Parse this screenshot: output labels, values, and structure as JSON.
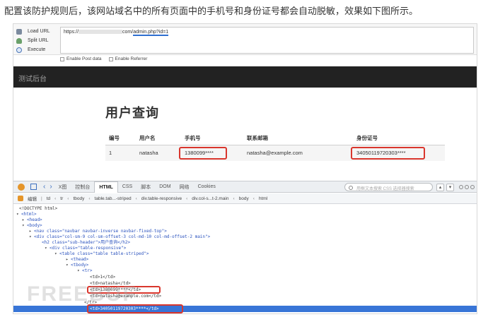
{
  "caption": "配置该防护规则后，该网站域名中的所有页面中的手机号和身份证号都会自动脱敏，效果如下图所示。",
  "hackbar": {
    "actions": [
      "Load URL",
      "Split URL",
      "Execute"
    ],
    "url_prefix": "https://",
    "url_mid": "com/",
    "url_highlight": "admin.php?id=1",
    "options": [
      "Enable Post data",
      "Enable Referrer"
    ]
  },
  "site": {
    "brand": "测试后台",
    "page_title": "用户查询",
    "columns": [
      "编号",
      "用户名",
      "手机号",
      "联系邮箱",
      "身份证号"
    ],
    "rows": [
      [
        "1",
        "natasha",
        "1380099****",
        "natasha@example.com",
        "34050119720303****"
      ]
    ]
  },
  "firebug": {
    "tabs": [
      "X图",
      "控制台",
      "HTML",
      "CSS",
      "脚本",
      "DOM",
      "网络",
      "Cookies"
    ],
    "active_tab": "HTML",
    "search_placeholder": "用框文本搜索 CSS 选择器搜索",
    "crumb_edit": "编辑",
    "crumbs": [
      "td",
      "tr",
      "tbody",
      "table.tab...-striped",
      "div.table-responsive",
      "div.col-s...t-2.main",
      "body",
      "html"
    ],
    "tree": [
      "<!DOCTYPE html>",
      "<html>",
      "<head>",
      "<body>",
      "<nav class=\"navbar navbar-inverse navbar-fixed-top\">",
      "<div class=\"col-sm-9 col-sm-offset-3 col-md-10 col-md-offset-2 main\">",
      "<h2 class=\"sub-header\">用户查询</h2>",
      "<div class=\"table-responsive\">",
      "<table class=\"table table-striped\">",
      "<thead>",
      "<tbody>",
      "<tr>",
      "<td>1</td>",
      "<td>natasha</td>",
      "<td>1380099****</td>",
      "<td>natasha@example.com</td>",
      "<td>34050119720303****</td>",
      "</tr>"
    ]
  },
  "watermark": "FREEBUF",
  "colors": {
    "nav_bg": "#222222",
    "highlight_red": "#d9362d",
    "selection_blue": "#3875d7",
    "link_blue": "#2f6fd0"
  }
}
